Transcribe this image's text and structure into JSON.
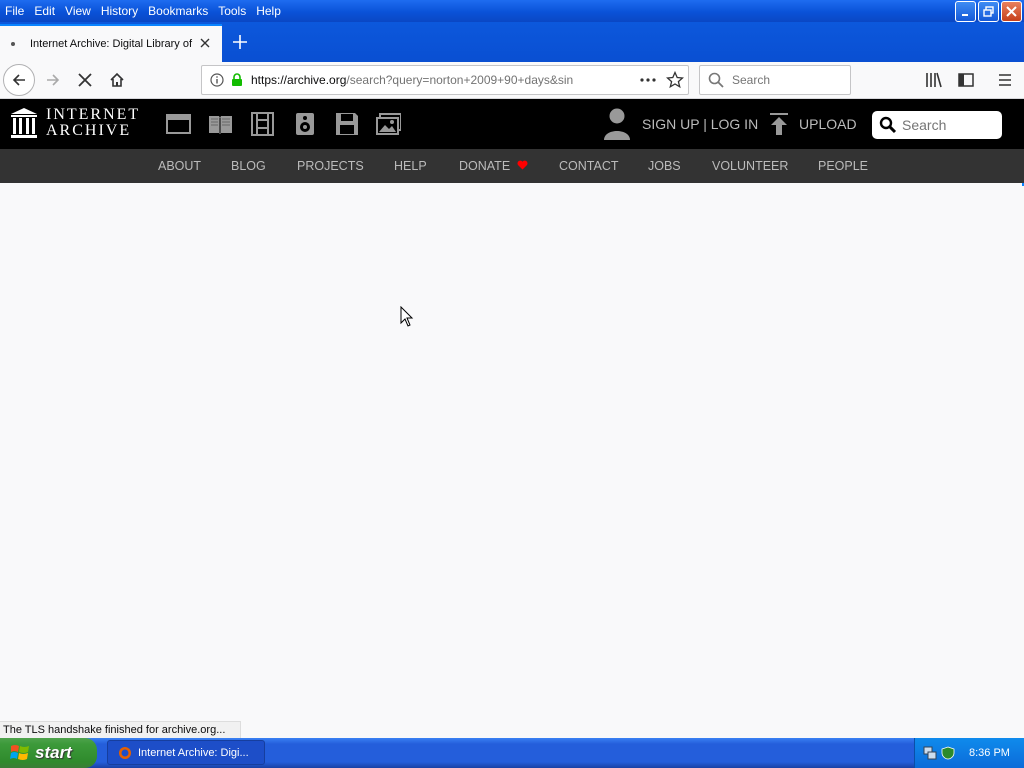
{
  "menubar": {
    "items": [
      "File",
      "Edit",
      "View",
      "History",
      "Bookmarks",
      "Tools",
      "Help"
    ]
  },
  "tab": {
    "title": "Internet Archive: Digital Library of"
  },
  "navbar": {
    "url_host": "https://archive.org",
    "url_path": "/search?query=norton+2009+90+days&sin",
    "search_placeholder": "Search"
  },
  "ia": {
    "logo_line1": "INTERNET",
    "logo_line2": "ARCHIVE",
    "signup_login": "SIGN UP | LOG IN",
    "upload": "UPLOAD",
    "search_placeholder": "Search",
    "nav": [
      "ABOUT",
      "BLOG",
      "PROJECTS",
      "HELP",
      "DONATE",
      "CONTACT",
      "JOBS",
      "VOLUNTEER",
      "PEOPLE"
    ]
  },
  "status": {
    "text": "The TLS handshake finished for archive.org..."
  },
  "taskbar": {
    "start": "start",
    "task_label": "Internet Archive: Digi...",
    "clock": "8:36 PM"
  },
  "colors": {
    "xp_blue": "#0a52d8",
    "ia_black": "#000000",
    "ia_nav": "#333333",
    "donate_heart": "#ff0000",
    "start_green": "#3c9a3a"
  }
}
